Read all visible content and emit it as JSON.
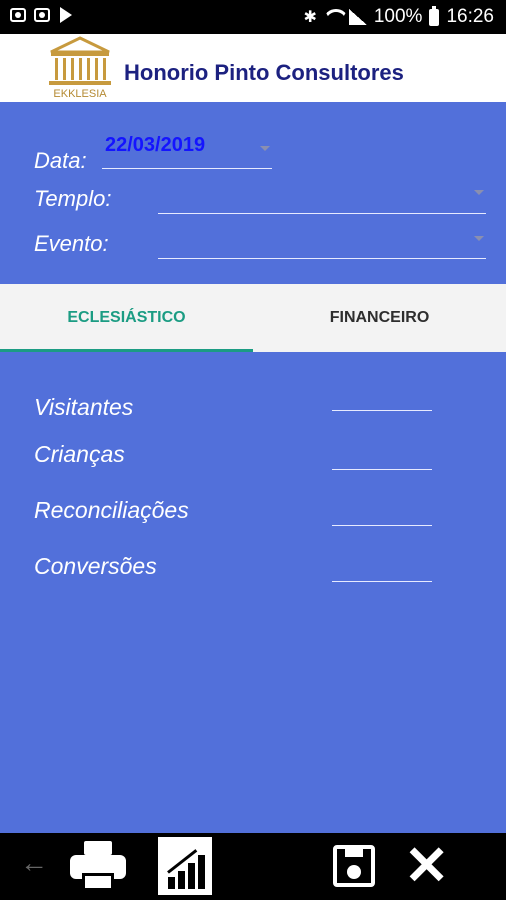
{
  "status_bar": {
    "battery": "100%",
    "time": "16:26"
  },
  "header": {
    "logo_text": "EKKLESIA",
    "title": "Honorio Pinto Consultores"
  },
  "form": {
    "date_label": "Data:",
    "date_value": "22/03/2019",
    "templo_label": "Templo:",
    "evento_label": "Evento:"
  },
  "tabs": [
    {
      "label": "ECLESIÁSTICO",
      "active": true
    },
    {
      "label": "FINANCEIRO",
      "active": false
    }
  ],
  "fields": [
    {
      "label": "Visitantes",
      "value": ""
    },
    {
      "label": "Crianças",
      "value": ""
    },
    {
      "label": "Reconciliações",
      "value": ""
    },
    {
      "label": "Conversões",
      "value": ""
    }
  ],
  "colors": {
    "background": "#5270da",
    "accent": "#1b9c83",
    "title": "#1c2180",
    "date": "#1414ff"
  },
  "icons": {
    "back": "back-arrow-icon",
    "print": "printer-icon",
    "chart": "chart-icon",
    "save": "save-icon",
    "close": "close-icon"
  }
}
